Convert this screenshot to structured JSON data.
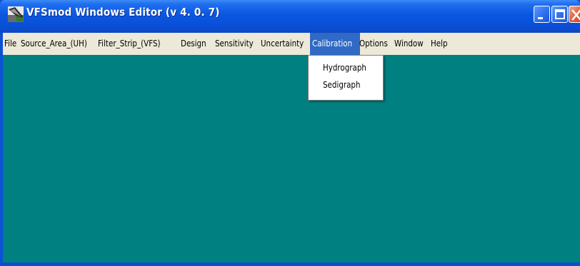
{
  "window": {
    "title": "VFSmod Windows Editor (v 4. 0. 7)",
    "icon": "vfsmod-app-icon",
    "controls": [
      "minimize-icon",
      "maximize-icon",
      "close-icon"
    ]
  },
  "menubar": {
    "items": [
      {
        "label": "File"
      },
      {
        "label": "Source_Area_(UH)"
      },
      {
        "label": "Filter_Strip_(VFS)"
      },
      {
        "label": "Design"
      },
      {
        "label": "Sensitivity"
      },
      {
        "label": "Uncertainty"
      },
      {
        "label": "Calibration",
        "active": true
      },
      {
        "label": "Options"
      },
      {
        "label": "Window"
      },
      {
        "label": "Help"
      }
    ]
  },
  "dropdown": {
    "parent": "Calibration",
    "items": [
      {
        "label": "Hydrograph"
      },
      {
        "label": "Sedigraph"
      }
    ]
  },
  "colors": {
    "titlebar": "#0a4fd6",
    "menubar": "#ece9d8",
    "menu_highlight": "#316ac5",
    "client_area": "#008080",
    "close_button": "#e3653e"
  }
}
